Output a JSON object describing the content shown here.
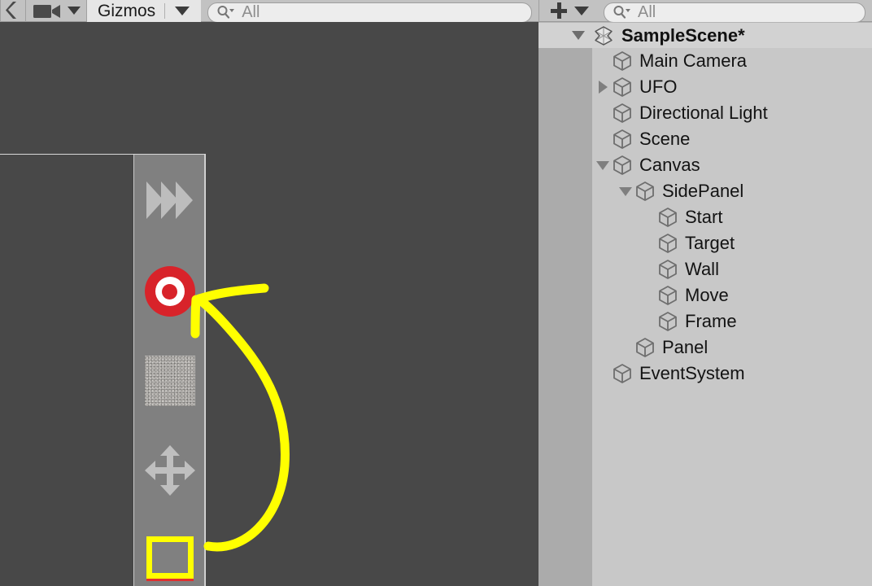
{
  "scene_toolbar": {
    "two_d_icon": "rotate-tool-icon",
    "camera_icon": "camera-icon",
    "camera_dropdown_icon": "chevron-down-icon",
    "gizmos_label": "Gizmos",
    "gizmos_dropdown_icon": "chevron-down-icon",
    "search": {
      "icon": "search-icon",
      "value": "",
      "placeholder": "All"
    }
  },
  "hierarchy_toolbar": {
    "add_icon": "plus-icon",
    "add_dropdown_icon": "chevron-down-icon",
    "search": {
      "icon": "search-icon",
      "value": "",
      "placeholder": "All"
    }
  },
  "hierarchy": {
    "scene": {
      "label": "SampleScene*",
      "icon": "unity-scene-icon",
      "foldout": "expanded"
    },
    "rows": [
      {
        "label": "Main Camera",
        "depth": 1,
        "foldout": "none",
        "icon": "gameobject-cube-icon"
      },
      {
        "label": "UFO",
        "depth": 1,
        "foldout": "collapsed",
        "icon": "gameobject-cube-icon"
      },
      {
        "label": "Directional Light",
        "depth": 1,
        "foldout": "none",
        "icon": "gameobject-cube-icon"
      },
      {
        "label": "Scene",
        "depth": 1,
        "foldout": "none",
        "icon": "gameobject-cube-icon"
      },
      {
        "label": "Canvas",
        "depth": 1,
        "foldout": "expanded",
        "icon": "gameobject-cube-icon"
      },
      {
        "label": "SidePanel",
        "depth": 2,
        "foldout": "expanded",
        "icon": "gameobject-cube-icon"
      },
      {
        "label": "Start",
        "depth": 3,
        "foldout": "none",
        "icon": "gameobject-cube-icon"
      },
      {
        "label": "Target",
        "depth": 3,
        "foldout": "none",
        "icon": "gameobject-cube-icon"
      },
      {
        "label": "Wall",
        "depth": 3,
        "foldout": "none",
        "icon": "gameobject-cube-icon"
      },
      {
        "label": "Move",
        "depth": 3,
        "foldout": "none",
        "icon": "gameobject-cube-icon"
      },
      {
        "label": "Frame",
        "depth": 3,
        "foldout": "none",
        "icon": "gameobject-cube-icon"
      },
      {
        "label": "Panel",
        "depth": 2,
        "foldout": "none",
        "icon": "gameobject-cube-icon"
      },
      {
        "label": "EventSystem",
        "depth": 1,
        "foldout": "none",
        "icon": "gameobject-cube-icon"
      }
    ]
  },
  "scene_view": {
    "side_panel_buttons": [
      {
        "name": "start-fast-forward-button",
        "icon": "fast-forward-icon"
      },
      {
        "name": "target-button",
        "icon": "target-bullseye-icon"
      },
      {
        "name": "wall-texture-button",
        "icon": "noise-texture-swatch-icon"
      },
      {
        "name": "move-button",
        "icon": "move-four-arrows-icon"
      },
      {
        "name": "frame-button",
        "icon": "yellow-frame-square-icon"
      }
    ],
    "annotation": {
      "name": "yellow-curved-arrow-annotation",
      "color": "#ffff00",
      "points_to": "target-button"
    }
  },
  "colors": {
    "scene_background": "#484848",
    "toolbar_background": "#c2c2c2",
    "hierarchy_background": "#c8c8c8",
    "hierarchy_gutter": "#ababab",
    "hierarchy_scene_row": "#d2d2d2",
    "side_panel": "#808080",
    "accent_red": "#d8232a",
    "annotation_yellow": "#ffff00"
  }
}
